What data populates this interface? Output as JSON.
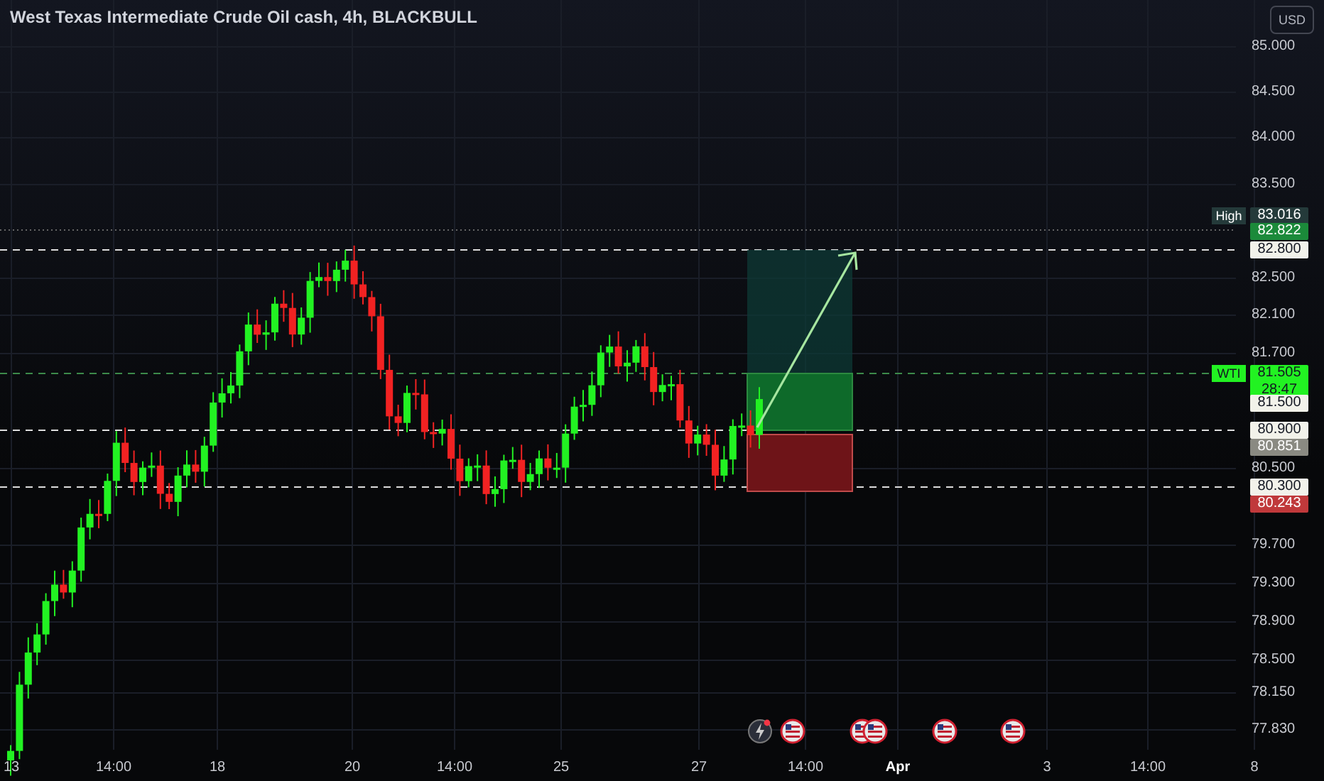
{
  "chart": {
    "title": "West Texas Intermediate Crude Oil cash, 4h, BLACKBULL",
    "currency_button": "USD"
  },
  "price_axis": {
    "labels": [
      "85.000",
      "84.500",
      "84.000",
      "83.500",
      "82.500",
      "82.100",
      "81.700",
      "80.500",
      "79.700",
      "79.300",
      "78.900",
      "78.500",
      "78.150",
      "77.830"
    ]
  },
  "price_tags": [
    {
      "label": "High",
      "value": "83.016",
      "color": "#243a3a"
    },
    {
      "value": "82.822",
      "color": "#1b8a3a"
    },
    {
      "value": "82.800",
      "color": "#f2f2ea"
    },
    {
      "label": "WTI",
      "value": "81.505",
      "countdown": "28:47",
      "color": "#22f222"
    },
    {
      "value": "81.500",
      "color": "#f2f2ea"
    },
    {
      "value": "80.900",
      "color": "#f2f2ea"
    },
    {
      "value": "80.851",
      "color": "#8a8a82"
    },
    {
      "value": "80.300",
      "color": "#f2f2ea"
    },
    {
      "value": "80.243",
      "color": "#c0393b"
    }
  ],
  "time_axis": {
    "labels": [
      {
        "text": "13",
        "bold": false
      },
      {
        "text": "14:00",
        "bold": false
      },
      {
        "text": "18",
        "bold": false
      },
      {
        "text": "20",
        "bold": false
      },
      {
        "text": "14:00",
        "bold": false
      },
      {
        "text": "25",
        "bold": false
      },
      {
        "text": "27",
        "bold": false
      },
      {
        "text": "14:00",
        "bold": false
      },
      {
        "text": "Apr",
        "bold": true
      },
      {
        "text": "3",
        "bold": false
      },
      {
        "text": "14:00",
        "bold": false
      },
      {
        "text": "8",
        "bold": false
      }
    ]
  },
  "events": [
    {
      "kind": "lightning"
    },
    {
      "kind": "flag"
    },
    {
      "kind": "flag"
    },
    {
      "kind": "flag"
    },
    {
      "kind": "flag"
    },
    {
      "kind": "flag"
    }
  ]
}
